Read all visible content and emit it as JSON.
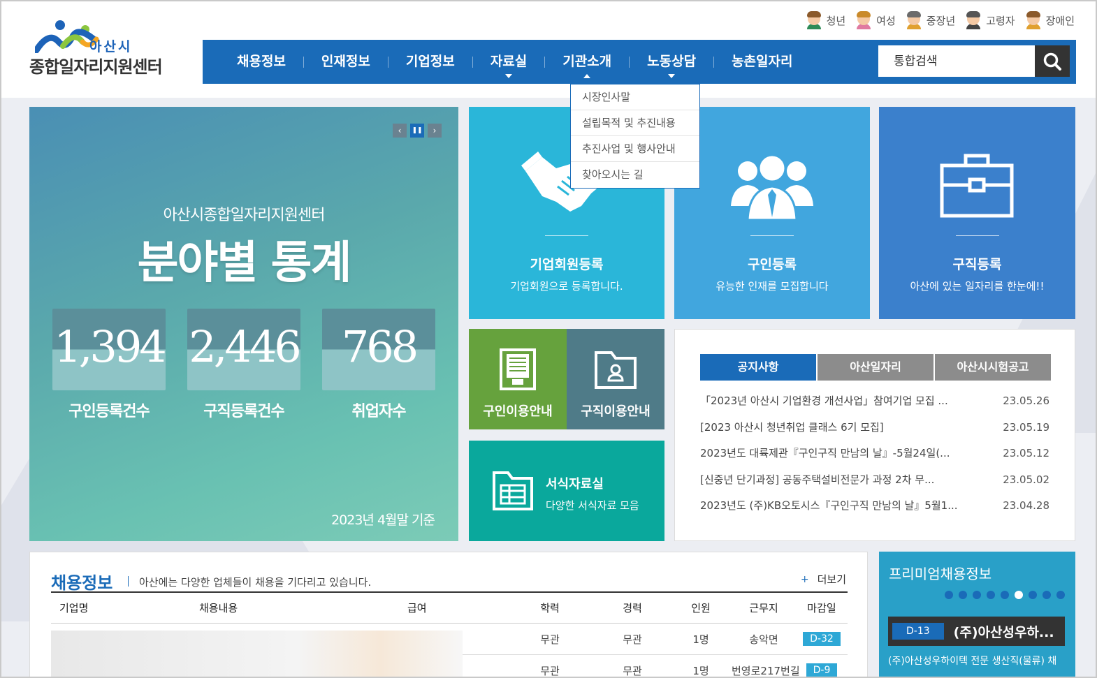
{
  "logo": {
    "city": "아산시",
    "name": "종합일자리지원센터"
  },
  "user_links": [
    {
      "label": "청년",
      "icon": "youth-avatar-icon",
      "hair": "#8b5a2b",
      "body": "#2e8b57"
    },
    {
      "label": "여성",
      "icon": "woman-avatar-icon",
      "hair": "#c98a2a",
      "body": "#e07aa0"
    },
    {
      "label": "중장년",
      "icon": "middle-aged-avatar-icon",
      "hair": "#6b6b6b",
      "body": "#e0a030"
    },
    {
      "label": "고령자",
      "icon": "senior-avatar-icon",
      "hair": "#555555",
      "body": "#444444"
    },
    {
      "label": "장애인",
      "icon": "disabled-avatar-icon",
      "hair": "#8b5a2b",
      "body": "#e0a030"
    }
  ],
  "gnb": {
    "items": [
      "채용정보",
      "인재정보",
      "기업정보",
      "자료실",
      "기관소개",
      "노동상담",
      "농촌일자리"
    ],
    "search_placeholder": "통합검색"
  },
  "dropdown": [
    "시장인사말",
    "설립목적 및 추진내용",
    "추진사업 및 행사안내",
    "찾아오시는 길"
  ],
  "banner": {
    "subtitle": "아산시종합일자리지원센터",
    "title": "분야별 통계",
    "stats": [
      {
        "value": "1,394",
        "label": "구인등록건수"
      },
      {
        "value": "2,446",
        "label": "구직등록건수"
      },
      {
        "value": "768",
        "label": "취업자수"
      }
    ],
    "date": "2023년 4월말 기준",
    "controls": {
      "prev": "‹",
      "pause": "❚❚",
      "next": "›"
    }
  },
  "tiles": {
    "company": {
      "title": "기업회원등록",
      "desc": "기업회원으로 등록합니다."
    },
    "recruit": {
      "title": "구인등록",
      "desc": "유능한 인재를 모집합니다"
    },
    "seek": {
      "title": "구직등록",
      "desc": "아산에 있는 일자리를 한눈에!!"
    },
    "recruit_guide": {
      "title": "구인이용안내"
    },
    "seek_guide": {
      "title": "구직이용안내"
    },
    "forms": {
      "title": "서식자료실",
      "desc": "다양한 서식자료 모음"
    }
  },
  "notice": {
    "tabs": [
      "공지사항",
      "아산일자리",
      "아산시시험공고"
    ],
    "items": [
      {
        "title": "「2023년 아산시 기업환경 개선사업」참여기업 모집 ...",
        "date": "23.05.26"
      },
      {
        "title": "[2023 아산시 청년취업 클래스 6기 모집]",
        "date": "23.05.19"
      },
      {
        "title": "2023년도 대륙제관『구인구직 만남의 날』-5월24일(...",
        "date": "23.05.12"
      },
      {
        "title": "[신중년 단기과정] 공동주택설비전문가 과정 2차 무...",
        "date": "23.05.02"
      },
      {
        "title": "2023년도 (주)KB오토시스『구인구직 만남의 날』5월1...",
        "date": "23.04.28"
      }
    ]
  },
  "jobs": {
    "title": "채용정보",
    "subtitle": "아산에는 다양한 업체들이 채용을 기다리고 있습니다.",
    "more_plus": "+",
    "more": "더보기",
    "headers": [
      "기업명",
      "채용내용",
      "급여",
      "학력",
      "경력",
      "인원",
      "근무지",
      "마감일"
    ],
    "rows": [
      {
        "edu": "무관",
        "exp": "무관",
        "count": "1명",
        "place": "송악면",
        "deadline": "D-32"
      },
      {
        "edu": "무관",
        "exp": "무관",
        "count": "1명",
        "place": "번영로217번길",
        "deadline": "D-9"
      }
    ]
  },
  "premium": {
    "title": "프리미엄채용정보",
    "dots": 9,
    "active_dot": 5,
    "badge": "D-13",
    "company": "(주)아산성우하...",
    "desc": "(주)아산성우하이텍 전문 생산직(물류) 채"
  },
  "colors": {
    "primary": "#1a6bb8",
    "banner": "#5aa8ac"
  }
}
